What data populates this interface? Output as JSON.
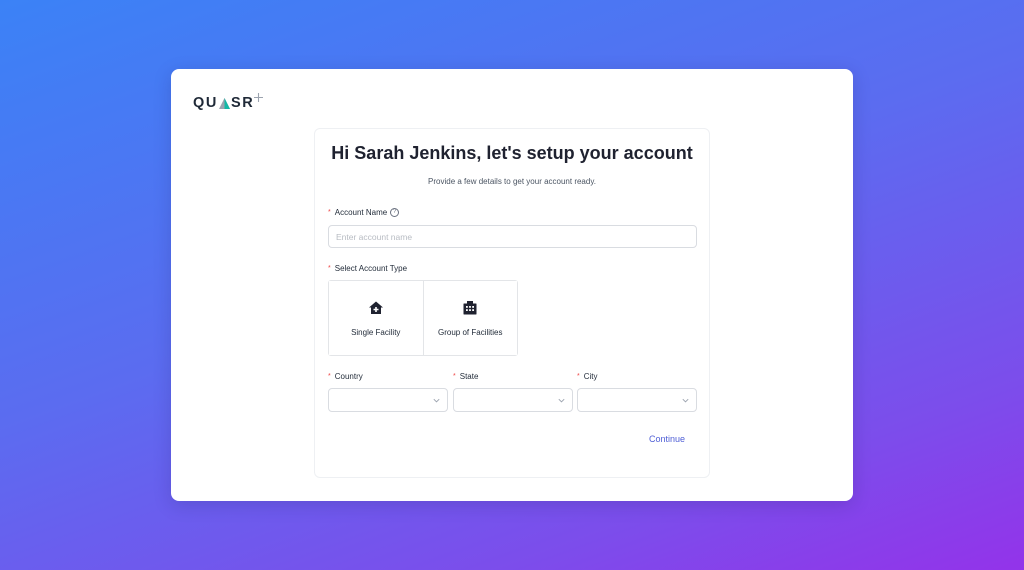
{
  "brand": {
    "logo_text_left": "QU",
    "logo_text_right": "SR"
  },
  "header": {
    "title": "Hi Sarah Jenkins, let's setup your account",
    "subtitle": "Provide a few details to get your account ready."
  },
  "form": {
    "required_mark": "*",
    "account_name": {
      "label": "Account Name",
      "help_icon": "question-circle-icon",
      "help_glyph": "?",
      "value": "",
      "placeholder": "Enter account name"
    },
    "account_type": {
      "label": "Select Account Type",
      "options": [
        {
          "label": "Single Facility",
          "icon": "home-plus-icon"
        },
        {
          "label": "Group of Facilities",
          "icon": "building-icon"
        }
      ]
    },
    "country": {
      "label": "Country",
      "value": ""
    },
    "state": {
      "label": "State",
      "value": ""
    },
    "city": {
      "label": "City",
      "value": ""
    },
    "continue_label": "Continue"
  },
  "colors": {
    "background_start": "#3b82f6",
    "background_end": "#9333ea",
    "link": "#4f5fd6",
    "required": "#ef4444"
  }
}
